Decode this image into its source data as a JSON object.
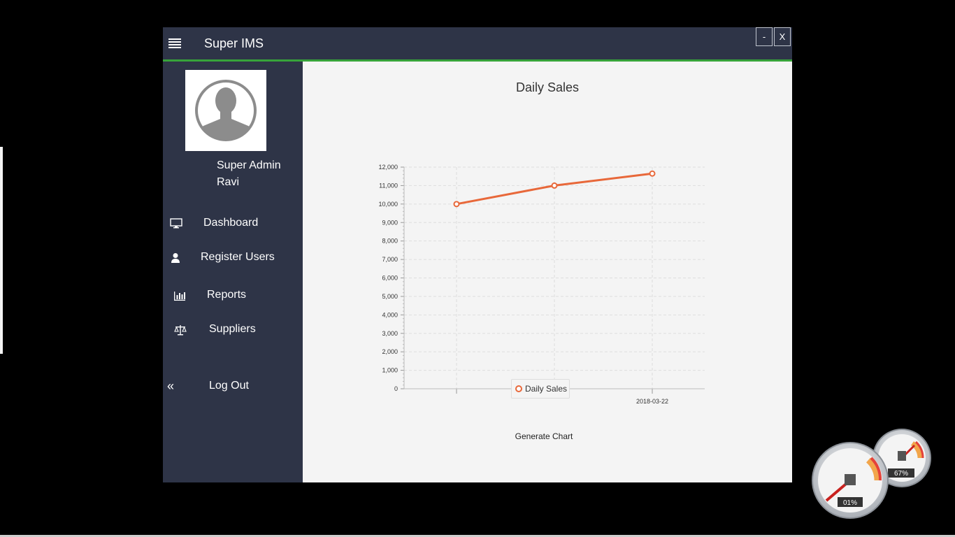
{
  "window": {
    "title": "Super IMS",
    "minimize_label": "-",
    "close_label": "X"
  },
  "user": {
    "role": "Super Admin",
    "name": "Ravi"
  },
  "nav": [
    {
      "label": "Dashboard",
      "icon": "monitor-icon"
    },
    {
      "label": "Register Users",
      "icon": "user-icon"
    },
    {
      "label": "Reports",
      "icon": "bar-chart-icon"
    },
    {
      "label": "Suppliers",
      "icon": "scale-icon"
    },
    {
      "label": "Log Out",
      "icon": "double-chevron-left-icon"
    }
  ],
  "chart_data": {
    "type": "line",
    "title": "Daily Sales",
    "x_ticks": [
      "",
      "",
      "2018-03-22"
    ],
    "series": [
      {
        "name": "Daily Sales",
        "values": [
          10000,
          11000,
          11650
        ]
      }
    ],
    "y_ticks": [
      "0",
      "1,000",
      "2,000",
      "3,000",
      "4,000",
      "5,000",
      "6,000",
      "7,000",
      "8,000",
      "9,000",
      "10,000",
      "11,000",
      "12,000"
    ],
    "ylim": [
      0,
      12000
    ],
    "grid": true,
    "legend": "bottom-center",
    "color": "#e8683a"
  },
  "actions": {
    "generate_chart": "Generate Chart"
  },
  "gadget": {
    "cpu": "01%",
    "memory": "67%"
  }
}
